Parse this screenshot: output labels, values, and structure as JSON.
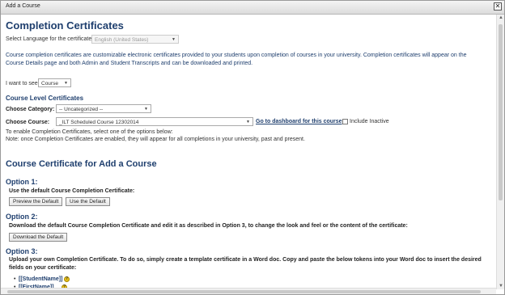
{
  "window": {
    "title": "Add a Course",
    "close_glyph": "✕"
  },
  "page": {
    "heading": "Completion Certificates",
    "language_label": "Select Language for the certificate:",
    "language_value": "English (United States)",
    "intro": "Course completion certificates are customizable electronic certificates provided to your students upon completion of courses in your university. Completion certificates will appear on the Course Details page and both Admin and Student Transcripts and can be downloaded and printed.",
    "want_to_see_label": "I want to see",
    "want_to_see_value": "Course"
  },
  "course_level": {
    "heading": "Course Level Certificates",
    "category_label": "Choose Category:",
    "category_value": "-- Uncategorized --",
    "course_label": "Choose Course:",
    "course_value": "_ILT Scheduled Course 12302014",
    "dashboard_link": "Go to dashboard for this course",
    "include_inactive": "Include Inactive",
    "enable_note": "To enable Completion Certificates, select one of the options below:",
    "note": "Note: once Completion Certificates are enabled, they will appear for all completions in your university, past and present."
  },
  "certificate_section": {
    "heading": "Course Certificate for Add a Course",
    "option1_title": "Option 1:",
    "option1_desc": "Use the default Course Completion Certificate:",
    "preview_button": "Preview the Default",
    "use_default_button": "Use the Default",
    "option2_title": "Option 2:",
    "option2_desc": "Download the default Course Completion Certificate and edit it as described in Option 3, to change the look and feel or the content of the certificate:",
    "download_button": "Download the Default",
    "option3_title": "Option 3:",
    "option3_desc": "Upload your own Completion Certificate. To do so, simply create a template certificate in a Word doc. Copy and paste the below tokens into your Word doc to insert the desired fields on your certificate:",
    "tokens": [
      "[[StudentName]]",
      "[[FirstName]]"
    ]
  },
  "icons": {
    "help": "help-icon",
    "close": "close-icon",
    "caret": "chevron-down-icon"
  }
}
